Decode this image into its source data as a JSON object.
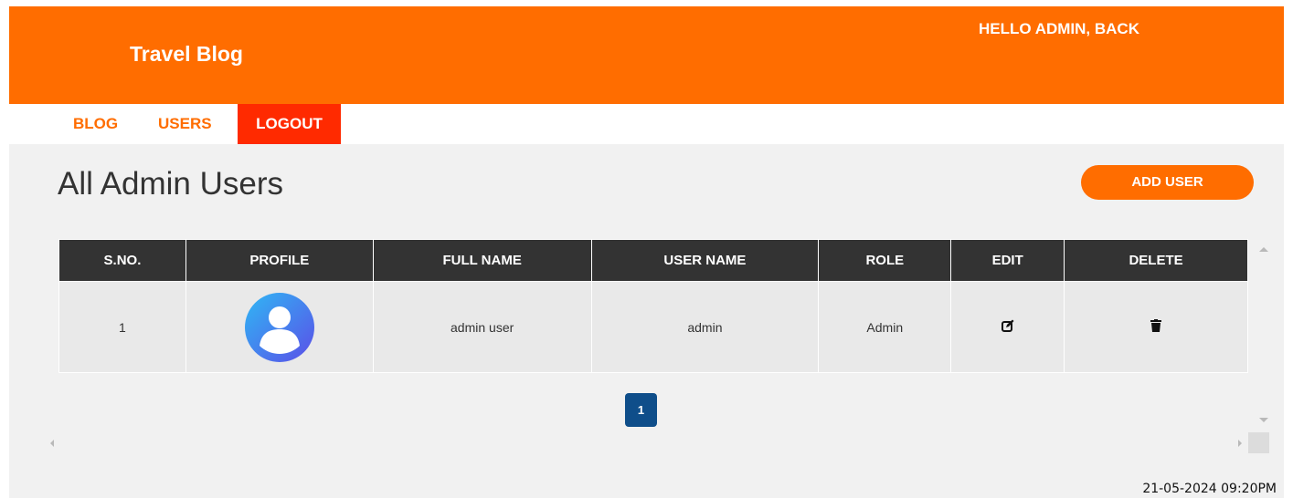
{
  "header": {
    "brand": "Travel Blog",
    "greeting": "HELLO ADMIN, BACK",
    "accent_color": "#ff6d00"
  },
  "nav": {
    "items": [
      {
        "label": "BLOG"
      },
      {
        "label": "USERS"
      },
      {
        "label": "LOGOUT"
      }
    ],
    "logout_color": "#ff2a00"
  },
  "main": {
    "title": "All Admin Users",
    "add_button": "ADD USER"
  },
  "table": {
    "columns": [
      "S.NO.",
      "PROFILE",
      "FULL NAME",
      "USER NAME",
      "ROLE",
      "EDIT",
      "DELETE"
    ],
    "rows": [
      {
        "sno": "1",
        "profile_icon": "avatar-user-icon",
        "full_name": "admin user",
        "user_name": "admin",
        "role": "Admin",
        "edit_icon": "edit-icon",
        "delete_icon": "trash-icon"
      }
    ]
  },
  "pagination": {
    "current": "1",
    "color": "#0f4e8a"
  },
  "footer": {
    "timestamp": "21-05-2024 09:20PM"
  }
}
